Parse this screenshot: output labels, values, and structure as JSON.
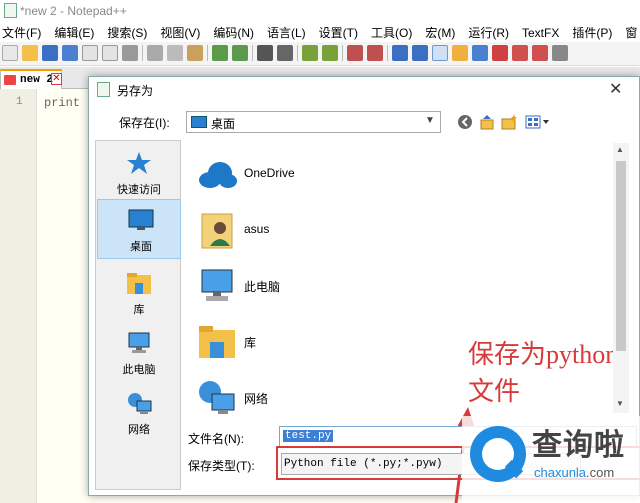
{
  "notepad": {
    "title": "*new 2 - Notepad++",
    "menu": [
      "文件(F)",
      "编辑(E)",
      "搜索(S)",
      "视图(V)",
      "编码(N)",
      "语言(L)",
      "设置(T)",
      "工具(O)",
      "宏(M)",
      "运行(R)",
      "TextFX",
      "插件(P)",
      "窗"
    ],
    "tab_label": "new 2",
    "tab_close": "✕",
    "line_number": "1",
    "code_text": "print"
  },
  "dialog": {
    "title": "另存为",
    "close_glyph": "✕",
    "save_in_label": "保存在(I):",
    "save_in_value": "桌面",
    "places": [
      {
        "label": "快速访问",
        "icon": "star-icon"
      },
      {
        "label": "桌面",
        "icon": "desktop-icon",
        "selected": true
      },
      {
        "label": "库",
        "icon": "library-icon"
      },
      {
        "label": "此电脑",
        "icon": "computer-icon"
      },
      {
        "label": "网络",
        "icon": "network-icon"
      }
    ],
    "files": [
      {
        "label": "OneDrive",
        "icon": "cloud-icon"
      },
      {
        "label": "asus",
        "icon": "user-folder-icon"
      },
      {
        "label": "此电脑",
        "icon": "computer-icon"
      },
      {
        "label": "库",
        "icon": "library-icon"
      },
      {
        "label": "网络",
        "icon": "network-icon"
      }
    ],
    "filename_label": "文件名(N):",
    "filename_value": "test.py",
    "filetype_label": "保存类型(T):",
    "filetype_value": "Python file (*.py;*.pyw)"
  },
  "annotation": "保存为python文件",
  "watermark": {
    "cn": "查询啦",
    "en_prefix": "chaxunla",
    "en_suffix": ".com"
  },
  "colors": {
    "annotation": "#d83a3a",
    "selection": "#3b7fd6",
    "accent": "#1e8be0"
  }
}
